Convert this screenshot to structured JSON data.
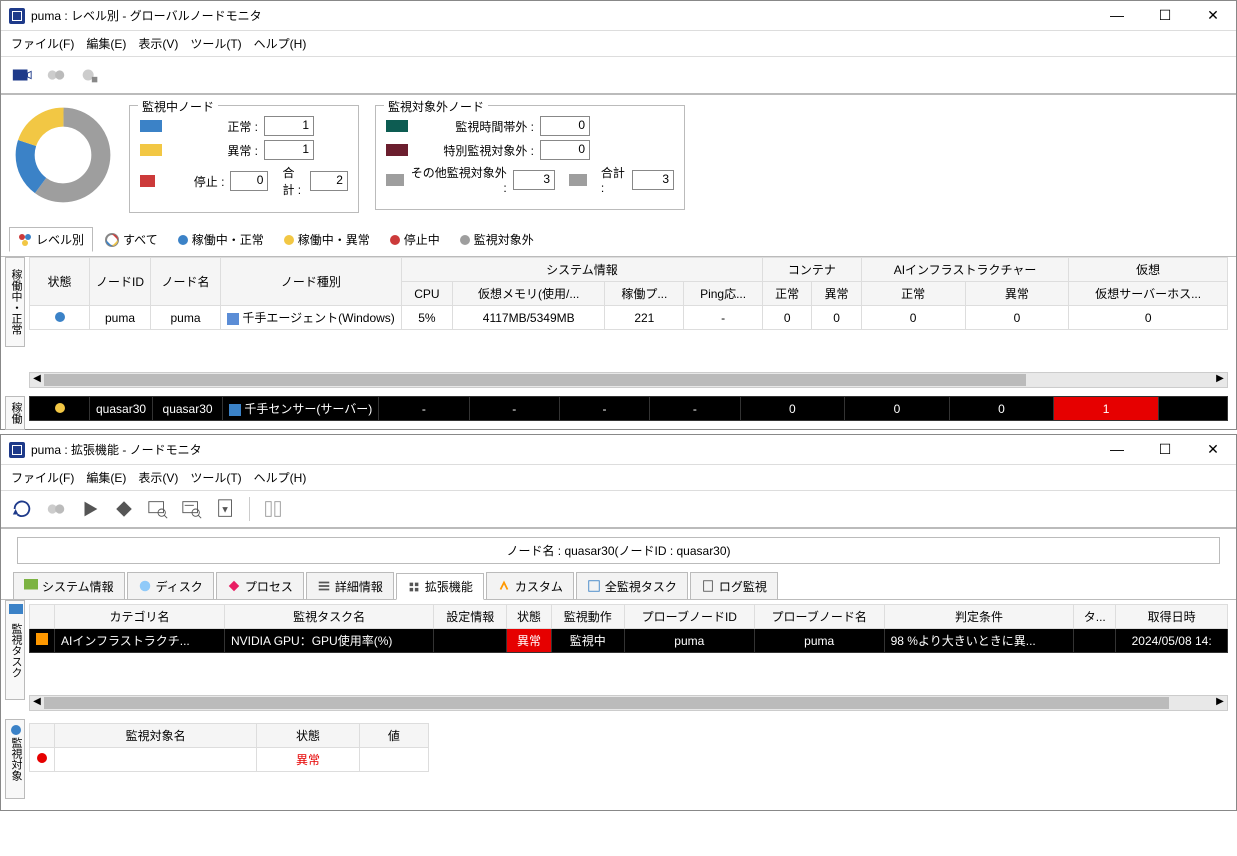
{
  "win1": {
    "title": "puma : レベル別 - グローバルノードモニタ",
    "menu": [
      "ファイル(F)",
      "編集(E)",
      "表示(V)",
      "ツール(T)",
      "ヘルプ(H)"
    ],
    "monitored": {
      "legend": "監視中ノード",
      "rows": [
        {
          "color": "#3b82c7",
          "label": "正常 :",
          "val": "1"
        },
        {
          "color": "#f2c744",
          "label": "異常 :",
          "val": "1"
        },
        {
          "color": "#cc3a3a",
          "label": "停止 :",
          "val": "0"
        }
      ],
      "total_label": "合計 :",
      "total": "2"
    },
    "excluded": {
      "legend": "監視対象外ノード",
      "rows": [
        {
          "color": "#0d5c52",
          "label": "監視時間帯外 :",
          "val": "0"
        },
        {
          "color": "#6b1e2e",
          "label": "特別監視対象外 :",
          "val": "0"
        },
        {
          "color": "#9e9e9e",
          "label": "その他監視対象外 :",
          "val": "3"
        }
      ],
      "total_label": "合計 :",
      "total": "3"
    },
    "tabs": [
      {
        "label": "レベル別",
        "active": true
      },
      {
        "label": "すべて"
      },
      {
        "label": "稼働中・正常",
        "dot": "#3b82c7"
      },
      {
        "label": "稼働中・異常",
        "dot": "#f2c744"
      },
      {
        "label": "停止中",
        "dot": "#cc3a3a"
      },
      {
        "label": "監視対象外",
        "dot": "#9e9e9e"
      }
    ],
    "headers_top": [
      "状態",
      "ノードID",
      "ノード名",
      "ノード種別",
      "システム情報",
      "コンテナ",
      "AIインフラストラクチャー",
      "仮想"
    ],
    "headers_sub": [
      "CPU",
      "仮想メモリ(使用/...",
      "稼働プ...",
      "Ping応...",
      "正常",
      "異常",
      "正常",
      "異常",
      "仮想サーバーホス..."
    ],
    "row1": {
      "id": "puma",
      "name": "puma",
      "type": "千手エージェント(Windows)",
      "cpu": "5%",
      "mem": "4117MB/5349MB",
      "proc": "221",
      "ping": "-",
      "c_ok": "0",
      "c_ng": "0",
      "a_ok": "0",
      "a_ng": "0",
      "vhost": "0"
    },
    "row2": {
      "id": "quasar30",
      "name": "quasar30",
      "type": "千手センサー(サーバー)",
      "cpu": "-",
      "mem": "-",
      "proc": "-",
      "ping": "-",
      "c_ok": "0",
      "c_ng": "0",
      "a_ok": "0",
      "a_ng": "1",
      "vhost": ""
    },
    "vtab1": "稼働中・正常",
    "vtab2": "稼働"
  },
  "win2": {
    "title": "puma : 拡張機能 - ノードモニタ",
    "menu": [
      "ファイル(F)",
      "編集(E)",
      "表示(V)",
      "ツール(T)",
      "ヘルプ(H)"
    ],
    "node_label": "ノード名 : quasar30(ノードID : quasar30)",
    "tabs": [
      "システム情報",
      "ディスク",
      "プロセス",
      "詳細情報",
      "拡張機能",
      "カスタム",
      "全監視タスク",
      "ログ監視"
    ],
    "active_tab": 4,
    "task_headers": [
      "カテゴリ名",
      "監視タスク名",
      "設定情報",
      "状態",
      "監視動作",
      "プローブノードID",
      "プローブノード名",
      "判定条件",
      "タ...",
      "取得日時"
    ],
    "task_row": {
      "cat": "AIインフラストラクチ...",
      "task": "NVIDIA GPU：GPU使用率(%)",
      "cfg": "",
      "state": "異常",
      "act": "監視中",
      "pid": "puma",
      "pname": "puma",
      "cond": "98 %より大きいときに異...",
      "t": "",
      "date": "2024/05/08 14:"
    },
    "target_headers": [
      "監視対象名",
      "状態",
      "値"
    ],
    "target_row": {
      "name": "",
      "state": "異常",
      "val": ""
    },
    "vtab_top": "監視タスク",
    "vtab_bot": "監視対象"
  },
  "chart_data": {
    "type": "pie",
    "title": "",
    "series": [
      {
        "name": "正常",
        "value": 1,
        "color": "#3b82c7"
      },
      {
        "name": "異常",
        "value": 1,
        "color": "#f2c744"
      },
      {
        "name": "停止",
        "value": 0,
        "color": "#cc3a3a"
      },
      {
        "name": "監視対象外",
        "value": 3,
        "color": "#9e9e9e"
      }
    ]
  }
}
